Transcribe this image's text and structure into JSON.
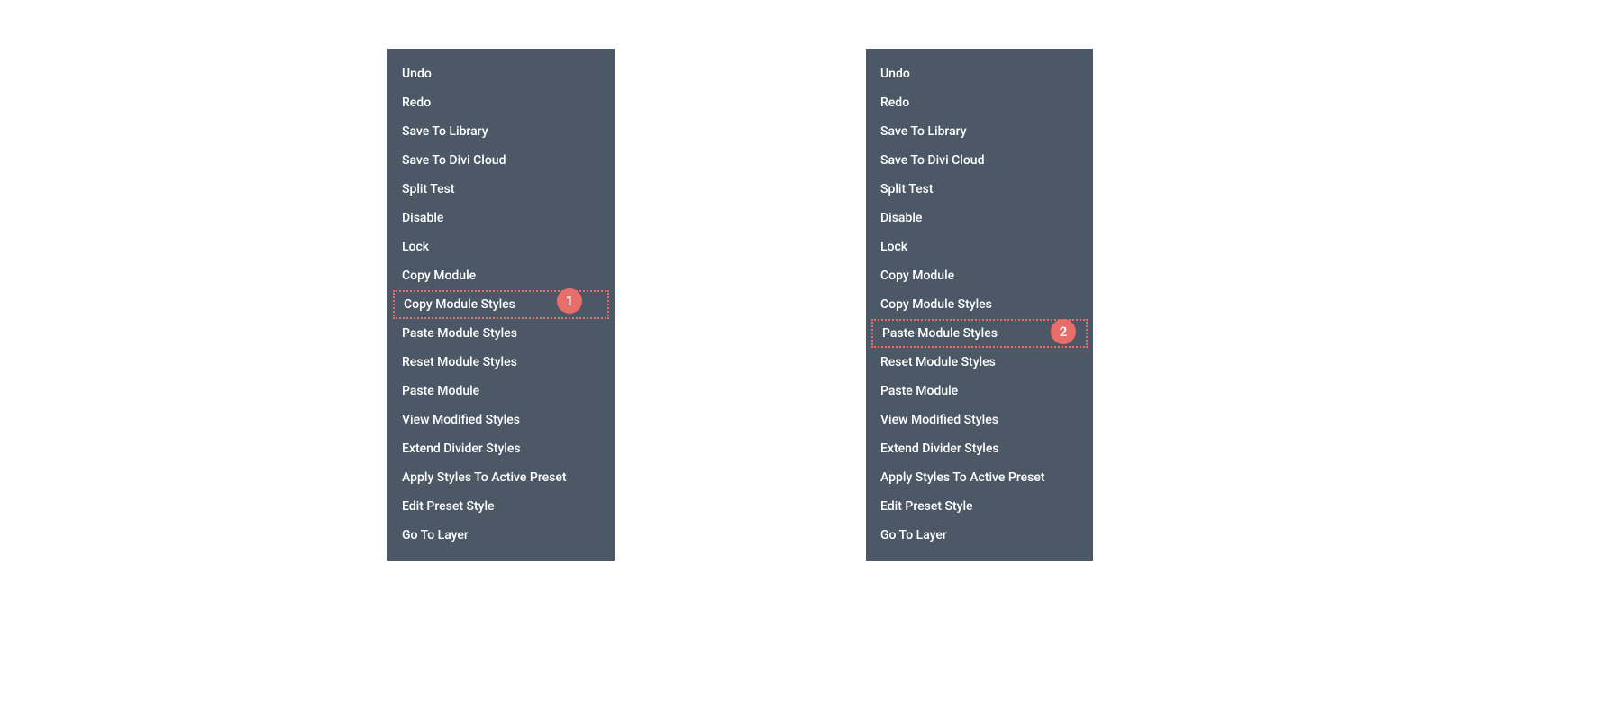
{
  "menus": {
    "left": {
      "items": [
        "Undo",
        "Redo",
        "Save To Library",
        "Save To Divi Cloud",
        "Split Test",
        "Disable",
        "Lock",
        "Copy Module",
        "Copy Module Styles",
        "Paste Module Styles",
        "Reset Module Styles",
        "Paste Module",
        "View Modified Styles",
        "Extend Divider Styles",
        "Apply Styles To Active Preset",
        "Edit Preset Style",
        "Go To Layer"
      ],
      "highlightedIndex": 8
    },
    "right": {
      "items": [
        "Undo",
        "Redo",
        "Save To Library",
        "Save To Divi Cloud",
        "Split Test",
        "Disable",
        "Lock",
        "Copy Module",
        "Copy Module Styles",
        "Paste Module Styles",
        "Reset Module Styles",
        "Paste Module",
        "View Modified Styles",
        "Extend Divider Styles",
        "Apply Styles To Active Preset",
        "Edit Preset Style",
        "Go To Layer"
      ],
      "highlightedIndex": 9
    }
  },
  "badges": {
    "b1": "1",
    "b2": "2"
  }
}
